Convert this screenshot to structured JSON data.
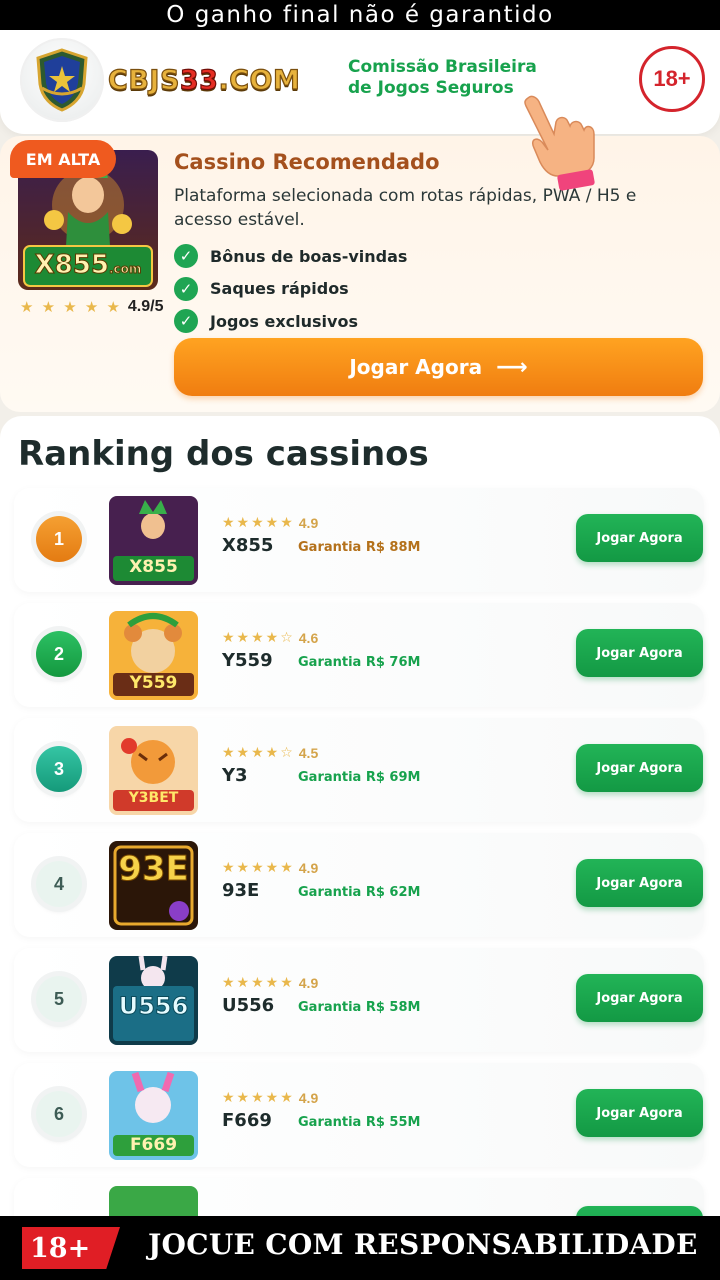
{
  "top_banner": {
    "text": "O ganho final não é garantido"
  },
  "header": {
    "brand_prefix": "CBJS",
    "brand_number": "33",
    "brand_suffix": ".COM",
    "commission_line1": "Comissão Brasileira",
    "commission_line2": "de Jogos Seguros",
    "age_badge": "18+",
    "logo_icon": "shield-star-icon"
  },
  "recommended": {
    "badge": "EM ALTA",
    "title": "Cassino Recomendado",
    "description": "Plataforma selecionada com rotas rápidas, PWA / H5 e acesso estável.",
    "logo_text": "X855",
    "logo_suffix": ".com",
    "stars": "★ ★ ★ ★ ★",
    "rating": "4.9/5",
    "features": [
      "Bônus de boas-vindas",
      "Saques rápidos",
      "Jogos exclusivos"
    ],
    "button_label": "Jogar Agora",
    "button_arrow": "⟶"
  },
  "ranking": {
    "title": "Ranking dos cassinos",
    "items": [
      {
        "rank": "1",
        "name": "X855",
        "stars": "★★★★★",
        "score": "4.9",
        "guarantee": "Garantia R$ 88M",
        "button": "Jogar Agora",
        "thumb_text": "X855"
      },
      {
        "rank": "2",
        "name": "Y559",
        "stars": "★★★★☆",
        "score": "4.6",
        "guarantee": "Garantia R$ 76M",
        "button": "Jogar Agora",
        "thumb_text": "Y559"
      },
      {
        "rank": "3",
        "name": "Y3",
        "stars": "★★★★☆",
        "score": "4.5",
        "guarantee": "Garantia R$ 69M",
        "button": "Jogar Agora",
        "thumb_text": "Y3BET"
      },
      {
        "rank": "4",
        "name": "93E",
        "stars": "★★★★★",
        "score": "4.9",
        "guarantee": "Garantia R$ 62M",
        "button": "Jogar Agora",
        "thumb_text": "93E"
      },
      {
        "rank": "5",
        "name": "U556",
        "stars": "★★★★★",
        "score": "4.9",
        "guarantee": "Garantia R$ 58M",
        "button": "Jogar Agora",
        "thumb_text": "U556"
      },
      {
        "rank": "6",
        "name": "F669",
        "stars": "★★★★★",
        "score": "4.9",
        "guarantee": "Garantia R$ 55M",
        "button": "Jogar Agora",
        "thumb_text": "F669"
      }
    ]
  },
  "bottom_banner": {
    "age": "18+",
    "text": "JOCUE COM RESPONSABILIDADE"
  },
  "colors": {
    "green": "#17a24d",
    "orange": "#f07d10",
    "red": "#d4242c",
    "gold": "#e9b84c"
  }
}
